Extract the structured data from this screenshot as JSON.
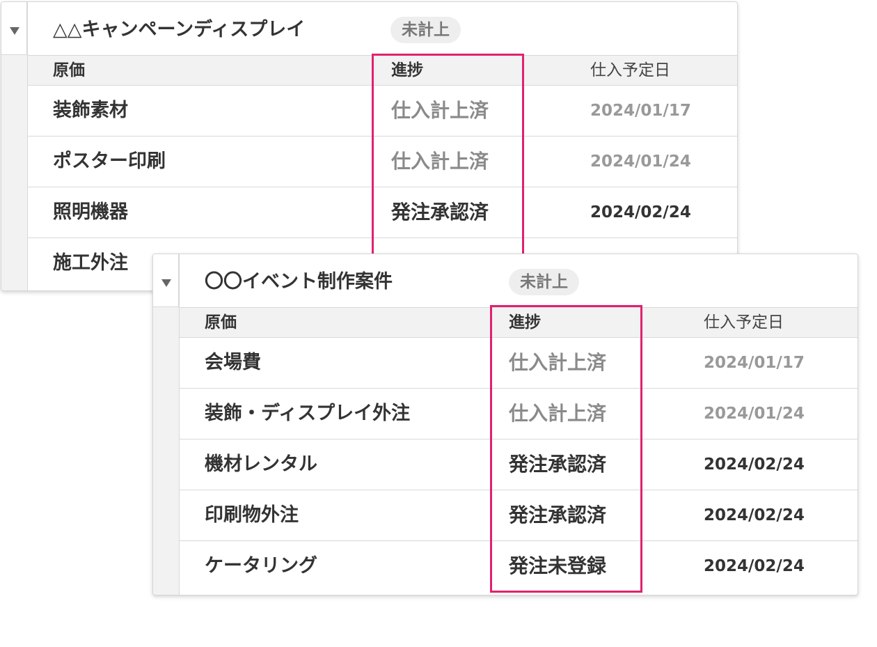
{
  "groups": [
    {
      "title": "△△キャンペーンディスプレイ",
      "status": "未計上",
      "headers": {
        "cost": "原価",
        "progress": "進捗",
        "date": "仕入予定日"
      },
      "rows": [
        {
          "name": "装飾素材",
          "progress": "仕入計上済",
          "date": "2024/01/17",
          "done": true
        },
        {
          "name": "ポスター印刷",
          "progress": "仕入計上済",
          "date": "2024/01/24",
          "done": true
        },
        {
          "name": "照明機器",
          "progress": "発注承認済",
          "date": "2024/02/24",
          "done": false
        },
        {
          "name": "施工外注",
          "progress": "",
          "date": "",
          "done": false
        }
      ]
    },
    {
      "title": "〇〇イベント制作案件",
      "status": "未計上",
      "headers": {
        "cost": "原価",
        "progress": "進捗",
        "date": "仕入予定日"
      },
      "rows": [
        {
          "name": "会場費",
          "progress": "仕入計上済",
          "date": "2024/01/17",
          "done": true
        },
        {
          "name": "装飾・ディスプレイ外注",
          "progress": "仕入計上済",
          "date": "2024/01/24",
          "done": true
        },
        {
          "name": "機材レンタル",
          "progress": "発注承認済",
          "date": "2024/02/24",
          "done": false
        },
        {
          "name": "印刷物外注",
          "progress": "発注承認済",
          "date": "2024/02/24",
          "done": false
        },
        {
          "name": "ケータリング",
          "progress": "発注未登録",
          "date": "2024/02/24",
          "done": false
        }
      ]
    }
  ],
  "colors": {
    "highlight": "#e0226e",
    "muted_text": "#8a8a8a",
    "strong_text": "#333333"
  }
}
